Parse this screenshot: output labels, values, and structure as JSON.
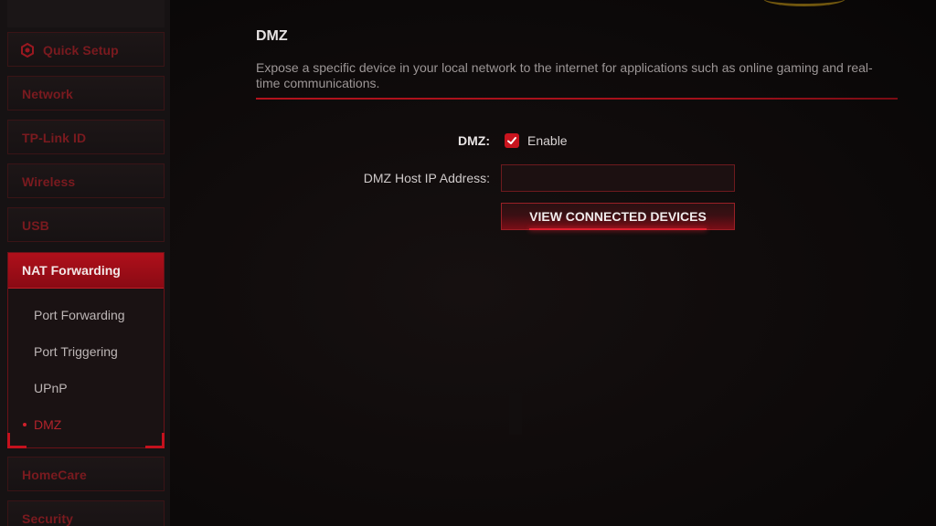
{
  "sidebar": {
    "quick_setup": {
      "label": "Quick Setup",
      "icon": "gear-icon"
    },
    "items": [
      {
        "label": "Network"
      },
      {
        "label": "TP-Link ID"
      },
      {
        "label": "Wireless"
      },
      {
        "label": "USB"
      }
    ],
    "nat_forwarding": {
      "label": "NAT Forwarding",
      "sub_items": [
        {
          "label": "Port Forwarding"
        },
        {
          "label": "Port Triggering"
        },
        {
          "label": "UPnP"
        },
        {
          "label": "DMZ",
          "active": true
        }
      ]
    },
    "after_items": [
      {
        "label": "HomeCare"
      },
      {
        "label": "Security"
      }
    ]
  },
  "main": {
    "title": "DMZ",
    "description": "Expose a specific device in your local network to the internet for applications such as online gaming and real-time communications.",
    "form": {
      "dmz_label": "DMZ:",
      "enable_label": "Enable",
      "enable_checked": true,
      "host_ip_label": "DMZ Host IP Address:",
      "host_ip_value": "",
      "view_devices_label": "VIEW CONNECTED DEVICES"
    }
  },
  "colors": {
    "accent": "#c8141e",
    "inactive_nav_text": "#7a1a1f",
    "background": "#0e0b0b"
  }
}
